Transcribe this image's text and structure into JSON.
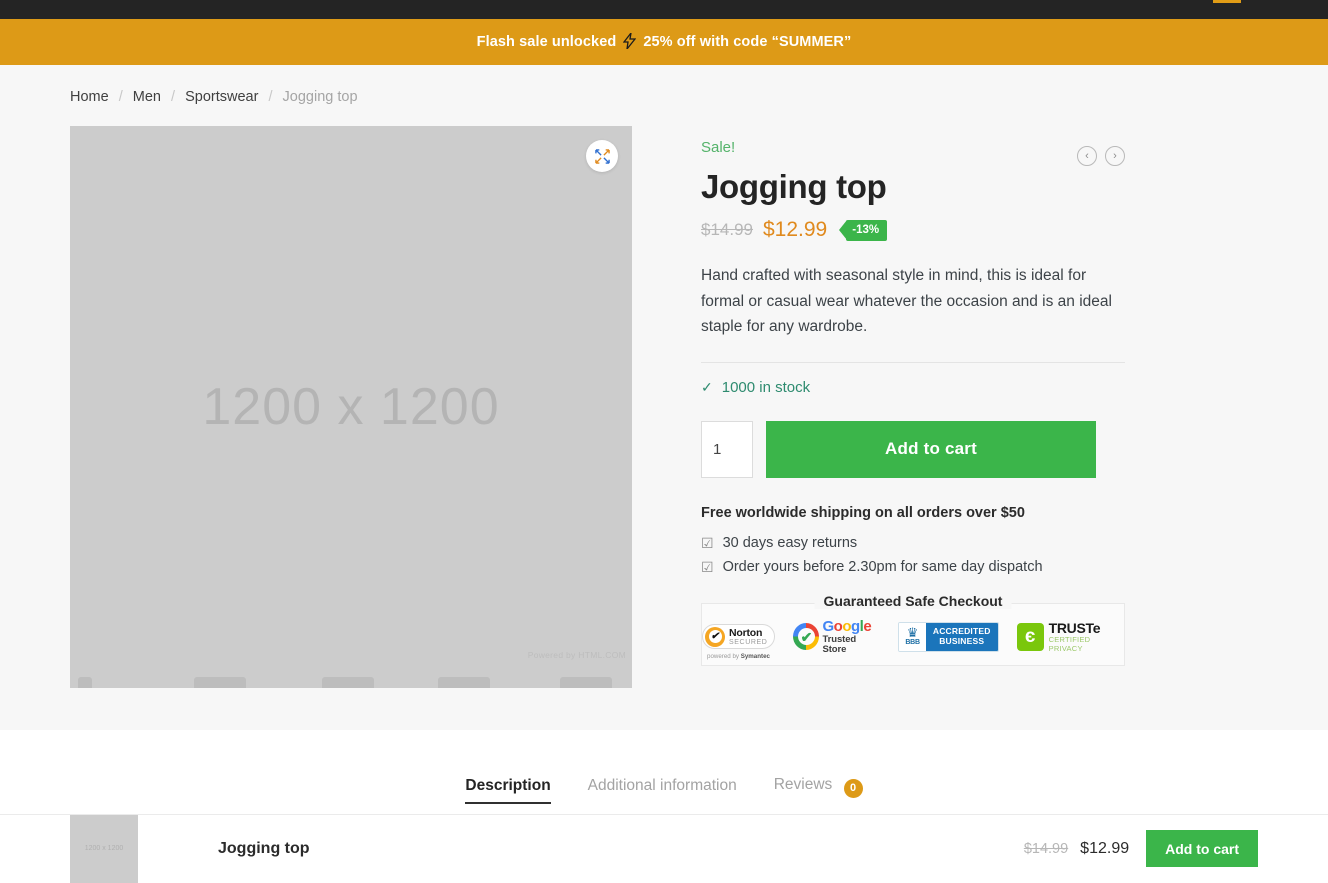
{
  "topbar": {
    "accent_color": "#e09c16"
  },
  "promo": {
    "text_before": "Flash sale unlocked",
    "bolt_icon": "lightning-bolt-icon",
    "bolt_glyph": "⚡",
    "text_after": "25% off with code “SUMMER”",
    "background": "#dd9a17"
  },
  "breadcrumb": {
    "items": [
      {
        "label": "Home",
        "current": false
      },
      {
        "label": "Men",
        "current": false
      },
      {
        "label": "Sportswear",
        "current": false
      },
      {
        "label": "Jogging top",
        "current": true
      }
    ],
    "separator": "/"
  },
  "gallery": {
    "placeholder_label": "1200 x 1200",
    "watermark": "Powered by HTML.COM",
    "expand_icon": "expand-arrows-icon",
    "expand_glyph": "⤧"
  },
  "summary": {
    "nav": {
      "prev_glyph": "‹",
      "next_glyph": "›"
    },
    "sale_flag": "Sale!",
    "title": "Jogging top",
    "price_old": "$14.99",
    "price_new": "$12.99",
    "discount_badge": "-13%",
    "accent_price_color": "#e08a1e",
    "sale_color": "#54b36a",
    "description": "Hand crafted with seasonal style in mind, this is ideal for formal or casual wear whatever the occasion and is an ideal staple for any wardrobe.",
    "stock": {
      "tick_glyph": "✓",
      "label": "1000 in stock",
      "color": "#2e8b6f"
    },
    "quantity_value": "1",
    "add_to_cart_label": "Add to cart",
    "cart_button_color": "#3bb54a",
    "shipping_note": "Free worldwide shipping on all orders over $50",
    "perks": [
      {
        "icon": "checkbox-checked-icon",
        "glyph": "☑",
        "label": "30 days easy returns"
      },
      {
        "icon": "checkbox-checked-icon",
        "glyph": "☑",
        "label": "Order yours before 2.30pm for same day dispatch"
      }
    ],
    "safe_checkout": {
      "title": "Guaranteed Safe Checkout",
      "badges": [
        {
          "name": "norton-secured-badge",
          "brand": "Norton",
          "sub": "SECURED",
          "footer_prefix": "powered by ",
          "footer_brand": "Symantec",
          "check_glyph": "✔"
        },
        {
          "name": "google-trusted-store-badge",
          "brand_parts": [
            {
              "t": "G",
              "c": "#4285f4"
            },
            {
              "t": "o",
              "c": "#ea4335"
            },
            {
              "t": "o",
              "c": "#fbbc05"
            },
            {
              "t": "g",
              "c": "#4285f4"
            },
            {
              "t": "l",
              "c": "#34a853"
            },
            {
              "t": "e",
              "c": "#ea4335"
            }
          ],
          "sub": "Trusted Store",
          "check_glyph": "✔"
        },
        {
          "name": "bbb-accredited-business-badge",
          "torch_glyph": "♛",
          "acronym": "BBB",
          "line1": "ACCREDITED",
          "line2": "BUSINESS"
        },
        {
          "name": "truste-certified-privacy-badge",
          "mark_glyph": "є",
          "brand": "TRUSTe",
          "sub": "CERTIFIED PRIVACY"
        }
      ]
    }
  },
  "tabs": [
    {
      "label": "Description",
      "active": true,
      "badge": null
    },
    {
      "label": "Additional information",
      "active": false,
      "badge": null
    },
    {
      "label": "Reviews",
      "active": false,
      "badge": "0"
    }
  ],
  "sticky_bar": {
    "thumb_label": "1200 x 1200",
    "title": "Jogging top",
    "price_old": "$14.99",
    "price_new": "$12.99",
    "add_to_cart_label": "Add to cart"
  }
}
